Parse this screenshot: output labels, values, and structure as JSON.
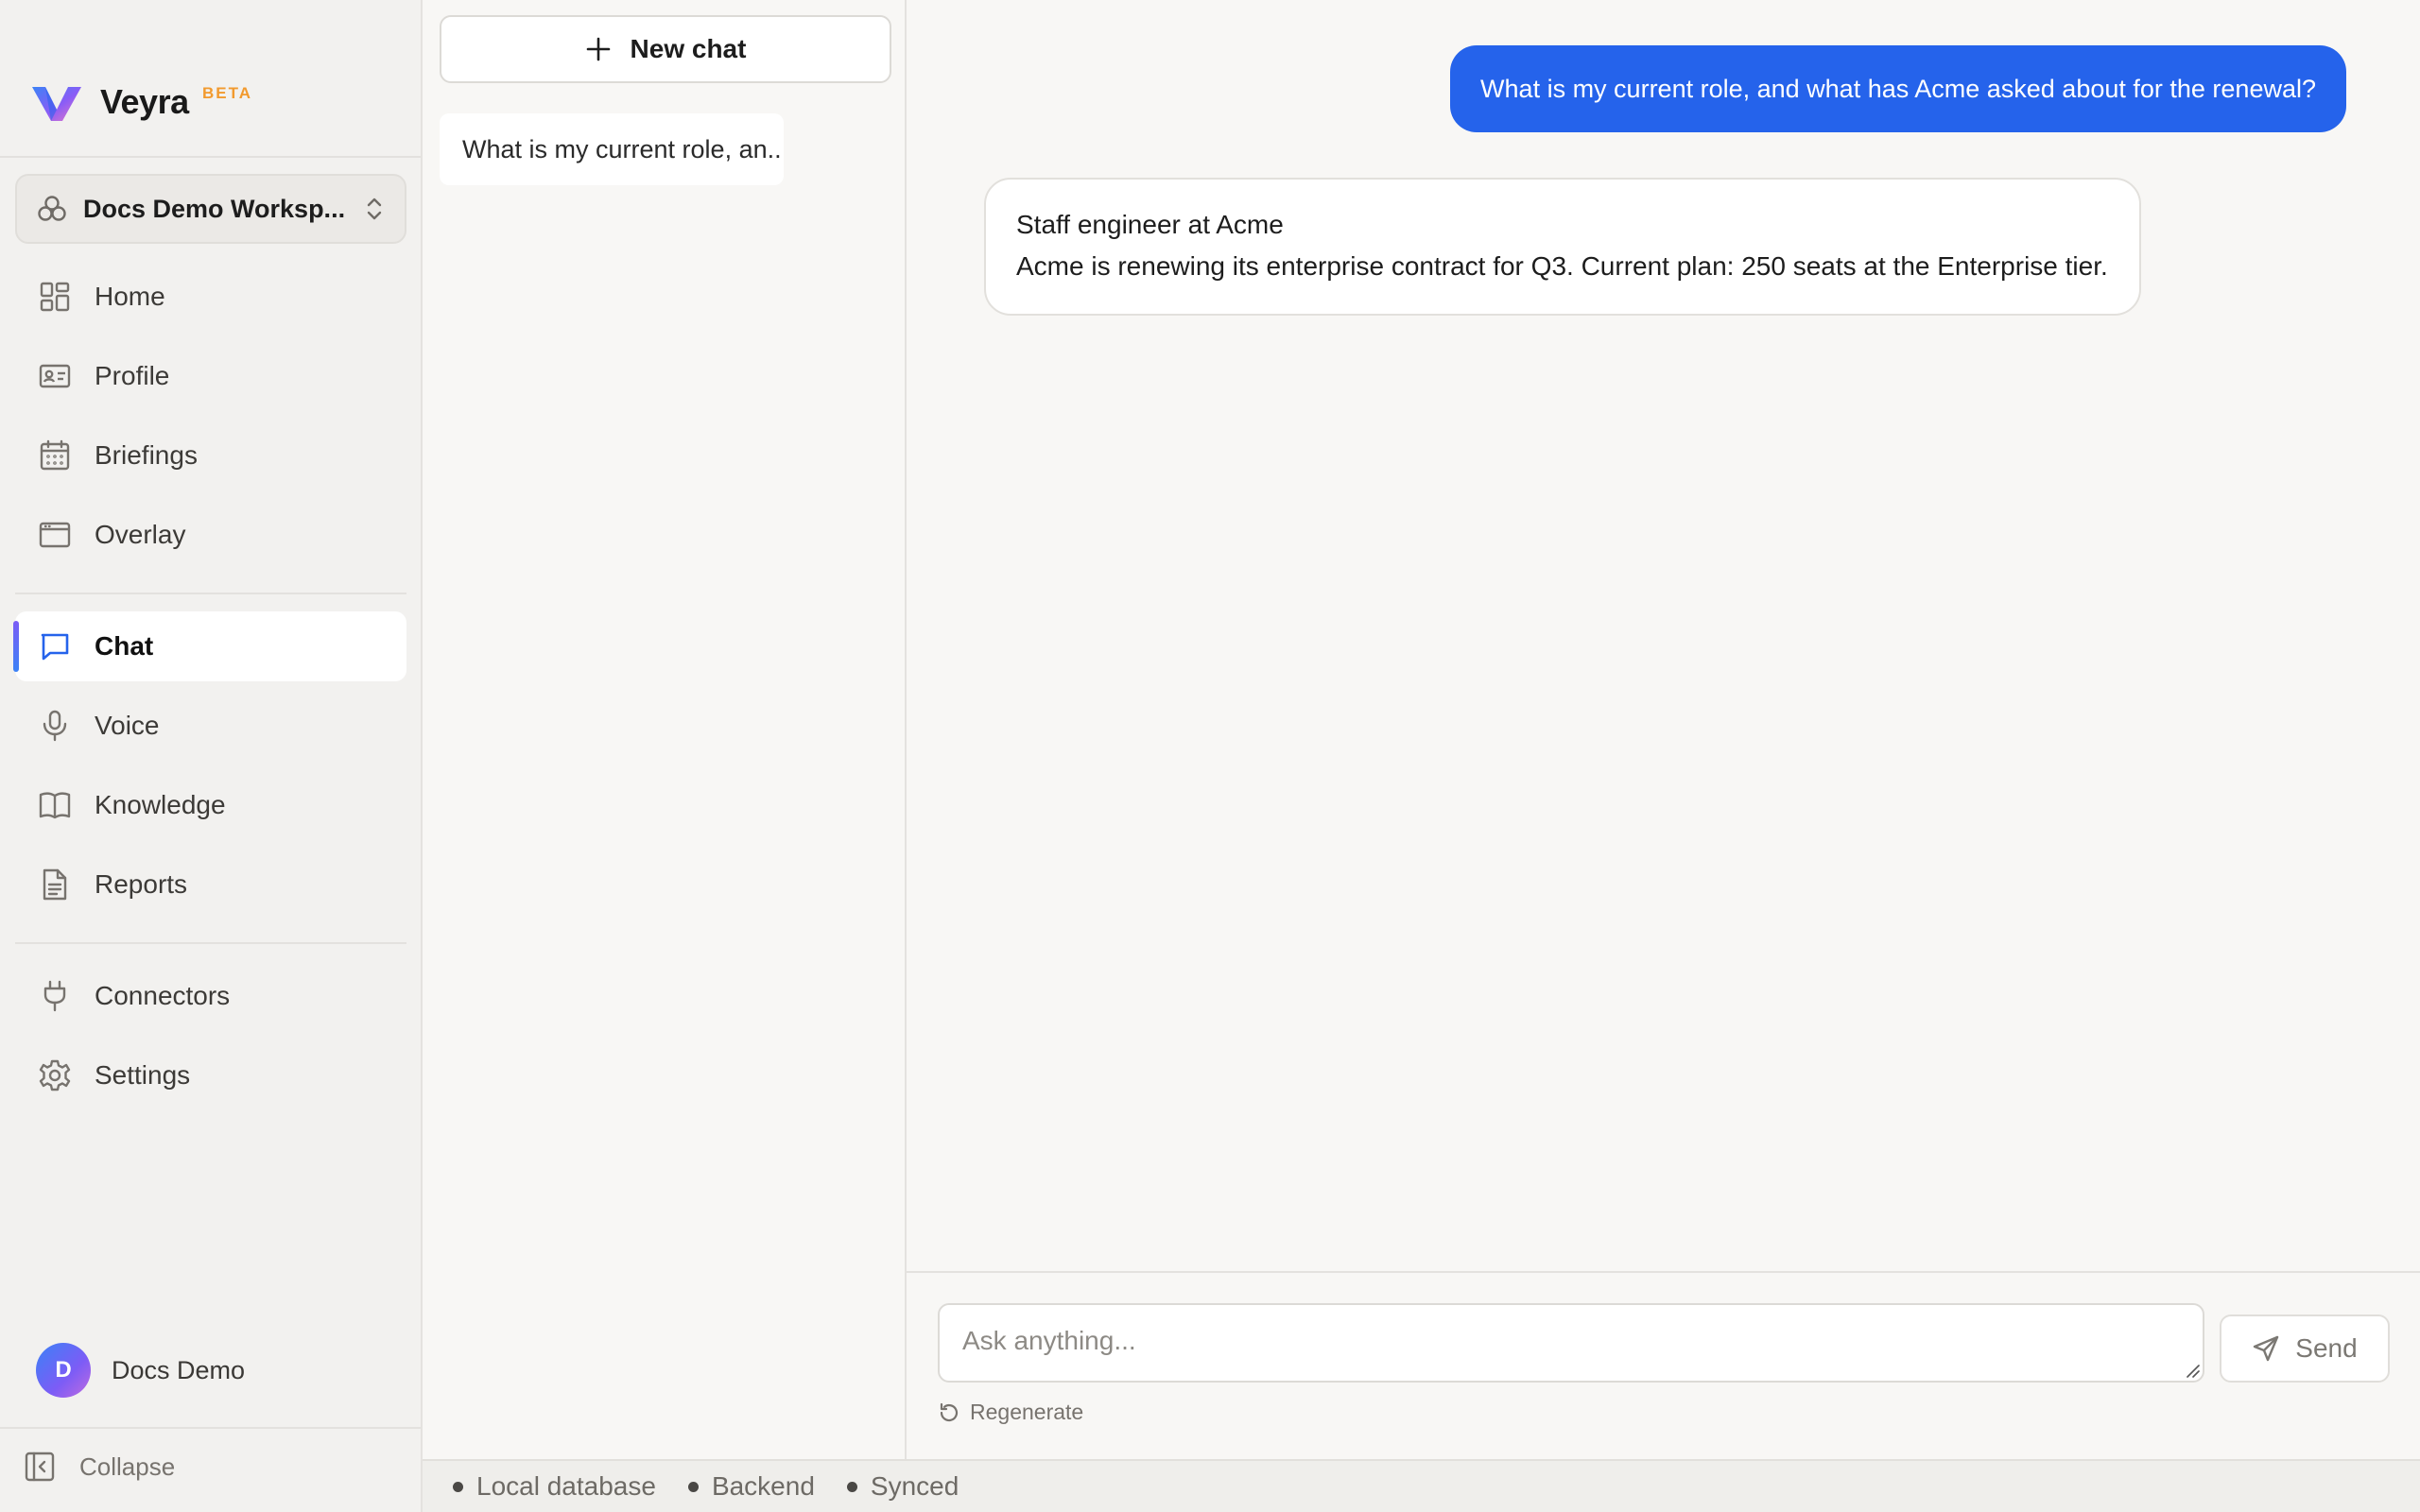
{
  "brand": {
    "name": "Veyra",
    "badge": "BETA",
    "badge_color": "#f29a2e"
  },
  "workspace": {
    "name": "Docs Demo Worksp..."
  },
  "nav": {
    "primary": [
      {
        "label": "Home",
        "icon": "grid-icon"
      },
      {
        "label": "Profile",
        "icon": "id-card-icon"
      },
      {
        "label": "Briefings",
        "icon": "calendar-icon"
      },
      {
        "label": "Overlay",
        "icon": "window-icon"
      }
    ],
    "secondary": [
      {
        "label": "Chat",
        "icon": "chat-bubble-icon",
        "active": true
      },
      {
        "label": "Voice",
        "icon": "microphone-icon"
      },
      {
        "label": "Knowledge",
        "icon": "book-icon"
      },
      {
        "label": "Reports",
        "icon": "document-icon"
      }
    ],
    "tertiary": [
      {
        "label": "Connectors",
        "icon": "plug-icon"
      },
      {
        "label": "Settings",
        "icon": "gear-icon"
      }
    ]
  },
  "user": {
    "initial": "D",
    "name": "Docs Demo"
  },
  "collapse_label": "Collapse",
  "chatlist": {
    "new_chat_label": "New chat",
    "items": [
      {
        "title": "What is my current role, an..."
      }
    ]
  },
  "conversation": {
    "user_message": "What is my current role, and what has Acme asked about for the renewal?",
    "assistant_lines": [
      "Staff engineer at Acme",
      "Acme is renewing its enterprise contract for Q3. Current plan: 250 seats at the Enterprise tier."
    ]
  },
  "composer": {
    "placeholder": "Ask anything...",
    "send_label": "Send",
    "regenerate_label": "Regenerate"
  },
  "status": {
    "items": [
      "Local database",
      "Backend",
      "Synced"
    ]
  },
  "colors": {
    "accent": "#2563eb",
    "sidebar_bg": "#f2f1ef",
    "page_bg": "#f8f7f5"
  }
}
